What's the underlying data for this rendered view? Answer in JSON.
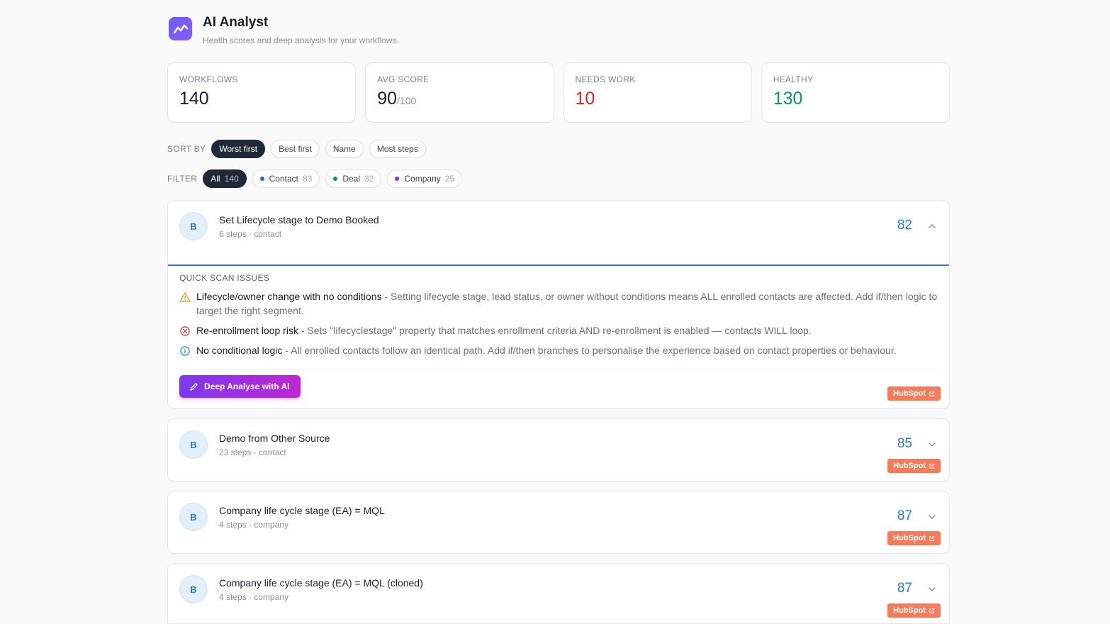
{
  "header": {
    "title": "AI Analyst",
    "subtitle": "Health scores and deep analysis for your workflows."
  },
  "stats": [
    {
      "label": "WORKFLOWS",
      "value": "140"
    },
    {
      "label": "AVG SCORE",
      "value": "90",
      "denom": "/100"
    },
    {
      "label": "NEEDS WORK",
      "value": "10"
    },
    {
      "label": "HEALTHY",
      "value": "130"
    }
  ],
  "sort": {
    "label": "SORT BY",
    "options": [
      "Worst first",
      "Best first",
      "Name",
      "Most steps"
    ],
    "selected": "Worst first"
  },
  "filter": {
    "label": "FILTER",
    "options": [
      {
        "label": "All",
        "count": "140",
        "color": ""
      },
      {
        "label": "Contact",
        "count": "83",
        "color": "#2563eb"
      },
      {
        "label": "Deal",
        "count": "32",
        "color": "#0f8f6e"
      },
      {
        "label": "Company",
        "count": "25",
        "color": "#7c3aed"
      }
    ]
  },
  "colors": {
    "accent_blue": "#2a7bbd",
    "hubspot": "#f47c5b",
    "needs_work": "#dc2626",
    "healthy": "#0f8f6e"
  },
  "workflows": [
    {
      "avatar": "B",
      "title": "Set Lifecycle stage to Demo Booked",
      "meta": "6 steps · contact",
      "score": "82",
      "expanded": true,
      "issues_label": "QUICK SCAN ISSUES",
      "issues": [
        {
          "icon": "warning-icon",
          "title": "Lifecycle/owner change with no conditions",
          "desc": " - Setting lifecycle stage, lead status, or owner without conditions means ALL enrolled contacts are affected. Add if/then logic to target the right segment."
        },
        {
          "icon": "error-icon",
          "title": "Re-enrollment loop risk",
          "desc": " - Sets \"lifecyclestage\" property that matches enrollment criteria AND re-enrollment is enabled — contacts WILL loop."
        },
        {
          "icon": "info-icon",
          "title": "No conditional logic",
          "desc": " - All enrolled contacts follow an identical path. Add if/then branches to personalise the experience based on contact properties or behaviour."
        }
      ],
      "deep_button": "Deep Analyse with AI",
      "hubspot": "HubSpot"
    },
    {
      "avatar": "B",
      "title": "Demo from Other Source",
      "meta": "23 steps · contact",
      "score": "85",
      "expanded": false,
      "hubspot": "HubSpot"
    },
    {
      "avatar": "B",
      "title": "Company life cycle stage (EA) = MQL",
      "meta": "4 steps · company",
      "score": "87",
      "expanded": false,
      "hubspot": "HubSpot"
    },
    {
      "avatar": "B",
      "title": "Company life cycle stage (EA) = MQL (cloned)",
      "meta": "4 steps · company",
      "score": "87",
      "expanded": false,
      "hubspot": "HubSpot"
    }
  ]
}
